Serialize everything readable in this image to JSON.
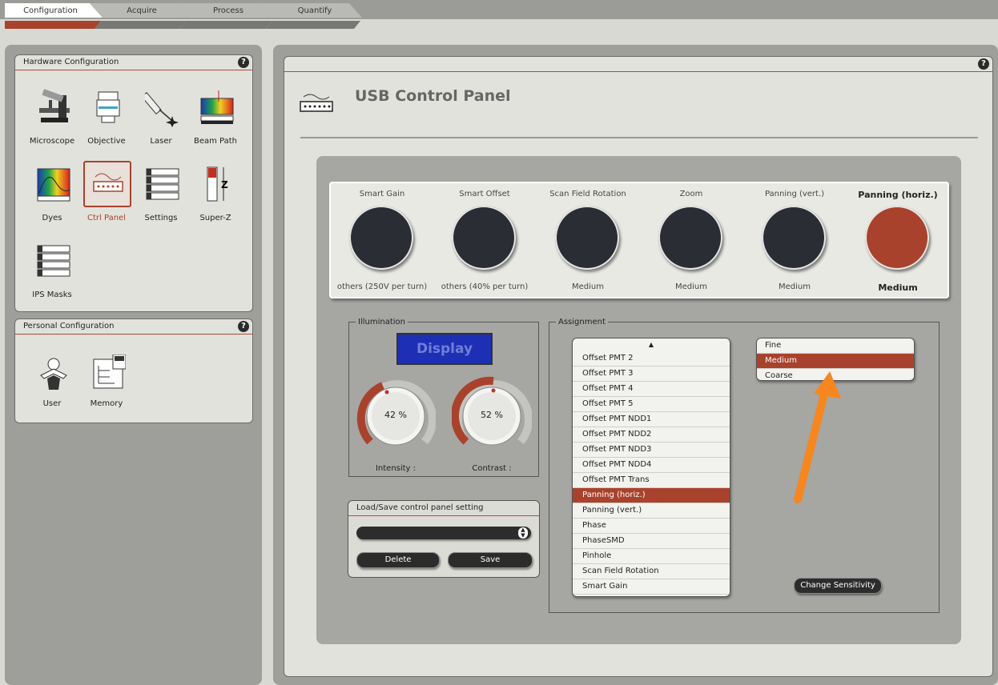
{
  "tabs": [
    "Configuration",
    "Acquire",
    "Process",
    "Quantify"
  ],
  "hardware": {
    "title": "Hardware Configuration",
    "items": [
      {
        "label": "Microscope",
        "icon": "microscope-icon"
      },
      {
        "label": "Objective",
        "icon": "objective-icon"
      },
      {
        "label": "Laser",
        "icon": "laser-icon"
      },
      {
        "label": "Beam Path",
        "icon": "beam-path-icon"
      },
      {
        "label": "Dyes",
        "icon": "dyes-icon"
      },
      {
        "label": "Ctrl Panel",
        "icon": "ctrl-panel-icon"
      },
      {
        "label": "Settings",
        "icon": "settings-icon"
      },
      {
        "label": "Super-Z",
        "icon": "super-z-icon"
      },
      {
        "label": "IPS Masks",
        "icon": "ips-masks-icon"
      }
    ]
  },
  "personal": {
    "title": "Personal Configuration",
    "items": [
      {
        "label": "User",
        "icon": "user-icon"
      },
      {
        "label": "Memory",
        "icon": "memory-icon"
      }
    ]
  },
  "main": {
    "title": "USB Control Panel",
    "knobs": [
      {
        "name": "Smart Gain",
        "setting": "others (250V per turn)"
      },
      {
        "name": "Smart Offset",
        "setting": "others (40% per turn)"
      },
      {
        "name": "Scan Field Rotation",
        "setting": "Medium"
      },
      {
        "name": "Zoom",
        "setting": "Medium"
      },
      {
        "name": "Panning (vert.)",
        "setting": "Medium"
      },
      {
        "name": "Panning (horiz.)",
        "setting": "Medium"
      }
    ],
    "illumination": {
      "legend": "Illumination",
      "display_label": "Display",
      "intensity_value": "42 %",
      "intensity_label": "Intensity :",
      "contrast_value": "52 %",
      "contrast_label": "Contrast :"
    },
    "loadsave": {
      "title": "Load/Save control panel setting",
      "delete_label": "Delete",
      "save_label": "Save"
    },
    "assignment": {
      "legend": "Assignment",
      "items": [
        "Offset PMT 2",
        "Offset PMT 3",
        "Offset PMT 4",
        "Offset PMT 5",
        "Offset PMT NDD1",
        "Offset PMT NDD2",
        "Offset PMT NDD3",
        "Offset PMT NDD4",
        "Offset PMT Trans",
        "Panning (horiz.)",
        "Panning (vert.)",
        "Phase",
        "PhaseSMD",
        "Pinhole",
        "Scan Field Rotation",
        "Smart Gain"
      ],
      "sensitivity": [
        "Fine",
        "Medium",
        "Coarse"
      ],
      "change_label": "Change Sensitivity"
    }
  },
  "colors": {
    "accent": "#a9422c",
    "knob": "#2a2d33"
  }
}
